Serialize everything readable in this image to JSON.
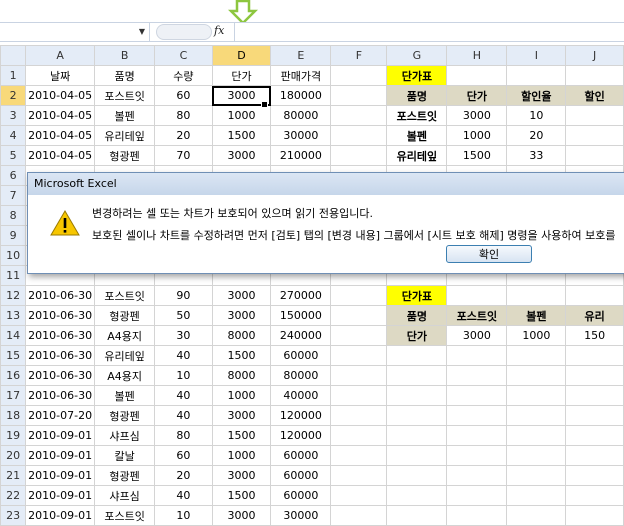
{
  "formula_bar": {
    "namebox_value": "",
    "fx_label": "fx",
    "formula_value": ""
  },
  "columns": [
    "A",
    "B",
    "C",
    "D",
    "E",
    "F",
    "G",
    "H",
    "I",
    "J"
  ],
  "selected_column": "D",
  "selected_row": "2",
  "rows": [
    {
      "n": "1",
      "a": "날짜",
      "b": "품명",
      "c": "수량",
      "d": "단가",
      "e": "판매가격",
      "g": "단가표",
      "h": "",
      "i": "",
      "j": ""
    },
    {
      "n": "2",
      "a": "2010-04-05",
      "b": "포스트잇",
      "c": "60",
      "d": "3000",
      "e": "180000",
      "g": "품명",
      "h": "단가",
      "i": "할인율",
      "j": "할인"
    },
    {
      "n": "3",
      "a": "2010-04-05",
      "b": "볼펜",
      "c": "80",
      "d": "1000",
      "e": "80000",
      "g": "포스트잇",
      "h": "3000",
      "i": "10",
      "j": ""
    },
    {
      "n": "4",
      "a": "2010-04-05",
      "b": "유리테잎",
      "c": "20",
      "d": "1500",
      "e": "30000",
      "g": "볼펜",
      "h": "1000",
      "i": "20",
      "j": ""
    },
    {
      "n": "5",
      "a": "2010-04-05",
      "b": "형광펜",
      "c": "70",
      "d": "3000",
      "e": "210000",
      "g": "유리테잎",
      "h": "1500",
      "i": "33",
      "j": ""
    },
    {
      "n": "6",
      "a": "",
      "b": "",
      "c": "",
      "d": "",
      "e": "",
      "g": "",
      "h": "",
      "i": "",
      "j": ""
    },
    {
      "n": "7",
      "a": "",
      "b": "",
      "c": "",
      "d": "",
      "e": "",
      "g": "",
      "h": "",
      "i": "",
      "j": ""
    },
    {
      "n": "8",
      "a": "",
      "b": "",
      "c": "",
      "d": "",
      "e": "",
      "g": "",
      "h": "",
      "i": "",
      "j": ""
    },
    {
      "n": "9",
      "a": "",
      "b": "",
      "c": "",
      "d": "",
      "e": "",
      "g": "",
      "h": "",
      "i": "",
      "j": ""
    },
    {
      "n": "10",
      "a": "",
      "b": "",
      "c": "",
      "d": "",
      "e": "",
      "g": "",
      "h": "",
      "i": "",
      "j": ""
    },
    {
      "n": "11",
      "a": "",
      "b": "",
      "c": "",
      "d": "",
      "e": "",
      "g": "",
      "h": "",
      "i": "",
      "j": ""
    },
    {
      "n": "12",
      "a": "2010-06-30",
      "b": "포스트잇",
      "c": "90",
      "d": "3000",
      "e": "270000",
      "g": "단가표",
      "h": "",
      "i": "",
      "j": ""
    },
    {
      "n": "13",
      "a": "2010-06-30",
      "b": "형광펜",
      "c": "50",
      "d": "3000",
      "e": "150000",
      "g": "품명",
      "h": "포스트잇",
      "i": "볼펜",
      "j": "유리"
    },
    {
      "n": "14",
      "a": "2010-06-30",
      "b": "A4용지",
      "c": "30",
      "d": "8000",
      "e": "240000",
      "g": "단가",
      "h": "3000",
      "i": "1000",
      "j": "150"
    },
    {
      "n": "15",
      "a": "2010-06-30",
      "b": "유리테잎",
      "c": "40",
      "d": "1500",
      "e": "60000",
      "g": "",
      "h": "",
      "i": "",
      "j": ""
    },
    {
      "n": "16",
      "a": "2010-06-30",
      "b": "A4용지",
      "c": "10",
      "d": "8000",
      "e": "80000",
      "g": "",
      "h": "",
      "i": "",
      "j": ""
    },
    {
      "n": "17",
      "a": "2010-06-30",
      "b": "볼펜",
      "c": "40",
      "d": "1000",
      "e": "40000",
      "g": "",
      "h": "",
      "i": "",
      "j": ""
    },
    {
      "n": "18",
      "a": "2010-07-20",
      "b": "형광펜",
      "c": "40",
      "d": "3000",
      "e": "120000",
      "g": "",
      "h": "",
      "i": "",
      "j": ""
    },
    {
      "n": "19",
      "a": "2010-09-01",
      "b": "샤프심",
      "c": "80",
      "d": "1500",
      "e": "120000",
      "g": "",
      "h": "",
      "i": "",
      "j": ""
    },
    {
      "n": "20",
      "a": "2010-09-01",
      "b": "칼날",
      "c": "60",
      "d": "1000",
      "e": "60000",
      "g": "",
      "h": "",
      "i": "",
      "j": ""
    },
    {
      "n": "21",
      "a": "2010-09-01",
      "b": "형광펜",
      "c": "20",
      "d": "3000",
      "e": "60000",
      "g": "",
      "h": "",
      "i": "",
      "j": ""
    },
    {
      "n": "22",
      "a": "2010-09-01",
      "b": "샤프심",
      "c": "40",
      "d": "1500",
      "e": "60000",
      "g": "",
      "h": "",
      "i": "",
      "j": ""
    },
    {
      "n": "23",
      "a": "2010-09-01",
      "b": "포스트잇",
      "c": "10",
      "d": "3000",
      "e": "30000",
      "g": "",
      "h": "",
      "i": "",
      "j": ""
    }
  ],
  "dialog": {
    "title": "Microsoft Excel",
    "message_line1": "변경하려는 셀 또는 차트가 보호되어 있으며 읽기 전용입니다.",
    "message_line2": "보호된 셀이나 차트를 수정하려면 먼저 [검토] 탭의 [변경 내용] 그룹에서 [시트 보호 해제] 명령을 사용하여 보호를",
    "ok_label": "확인"
  },
  "colors": {
    "header_bg": "#e4ecf7",
    "selected_header": "#f8d97a",
    "yellow_label": "#ffff00",
    "tan_header": "#ddd9c4",
    "arrow_green": "#8dc63f"
  }
}
